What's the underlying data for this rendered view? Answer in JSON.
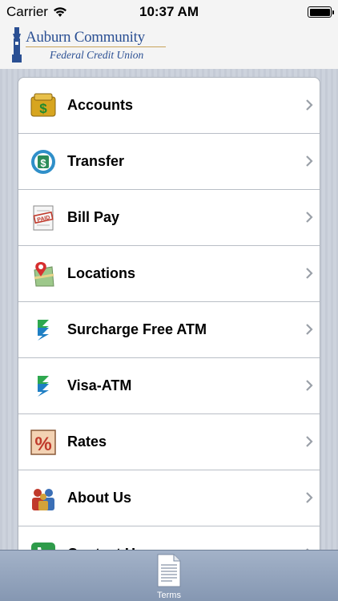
{
  "status_bar": {
    "carrier": "Carrier",
    "time": "10:37 AM"
  },
  "header": {
    "logo_line1": "Auburn Community",
    "logo_line2": "Federal Credit Union"
  },
  "menu": {
    "items": [
      {
        "label": "Accounts",
        "icon": "money-bag-icon"
      },
      {
        "label": "Transfer",
        "icon": "transfer-icon"
      },
      {
        "label": "Bill Pay",
        "icon": "bill-pay-icon"
      },
      {
        "label": "Locations",
        "icon": "map-pin-icon"
      },
      {
        "label": "Surcharge Free ATM",
        "icon": "atm-network-icon"
      },
      {
        "label": "Visa-ATM",
        "icon": "atm-network-icon"
      },
      {
        "label": "Rates",
        "icon": "percent-icon"
      },
      {
        "label": "About Us",
        "icon": "people-icon"
      },
      {
        "label": "Contact Us",
        "icon": "phone-icon"
      }
    ]
  },
  "tab_bar": {
    "terms_label": "Terms"
  }
}
